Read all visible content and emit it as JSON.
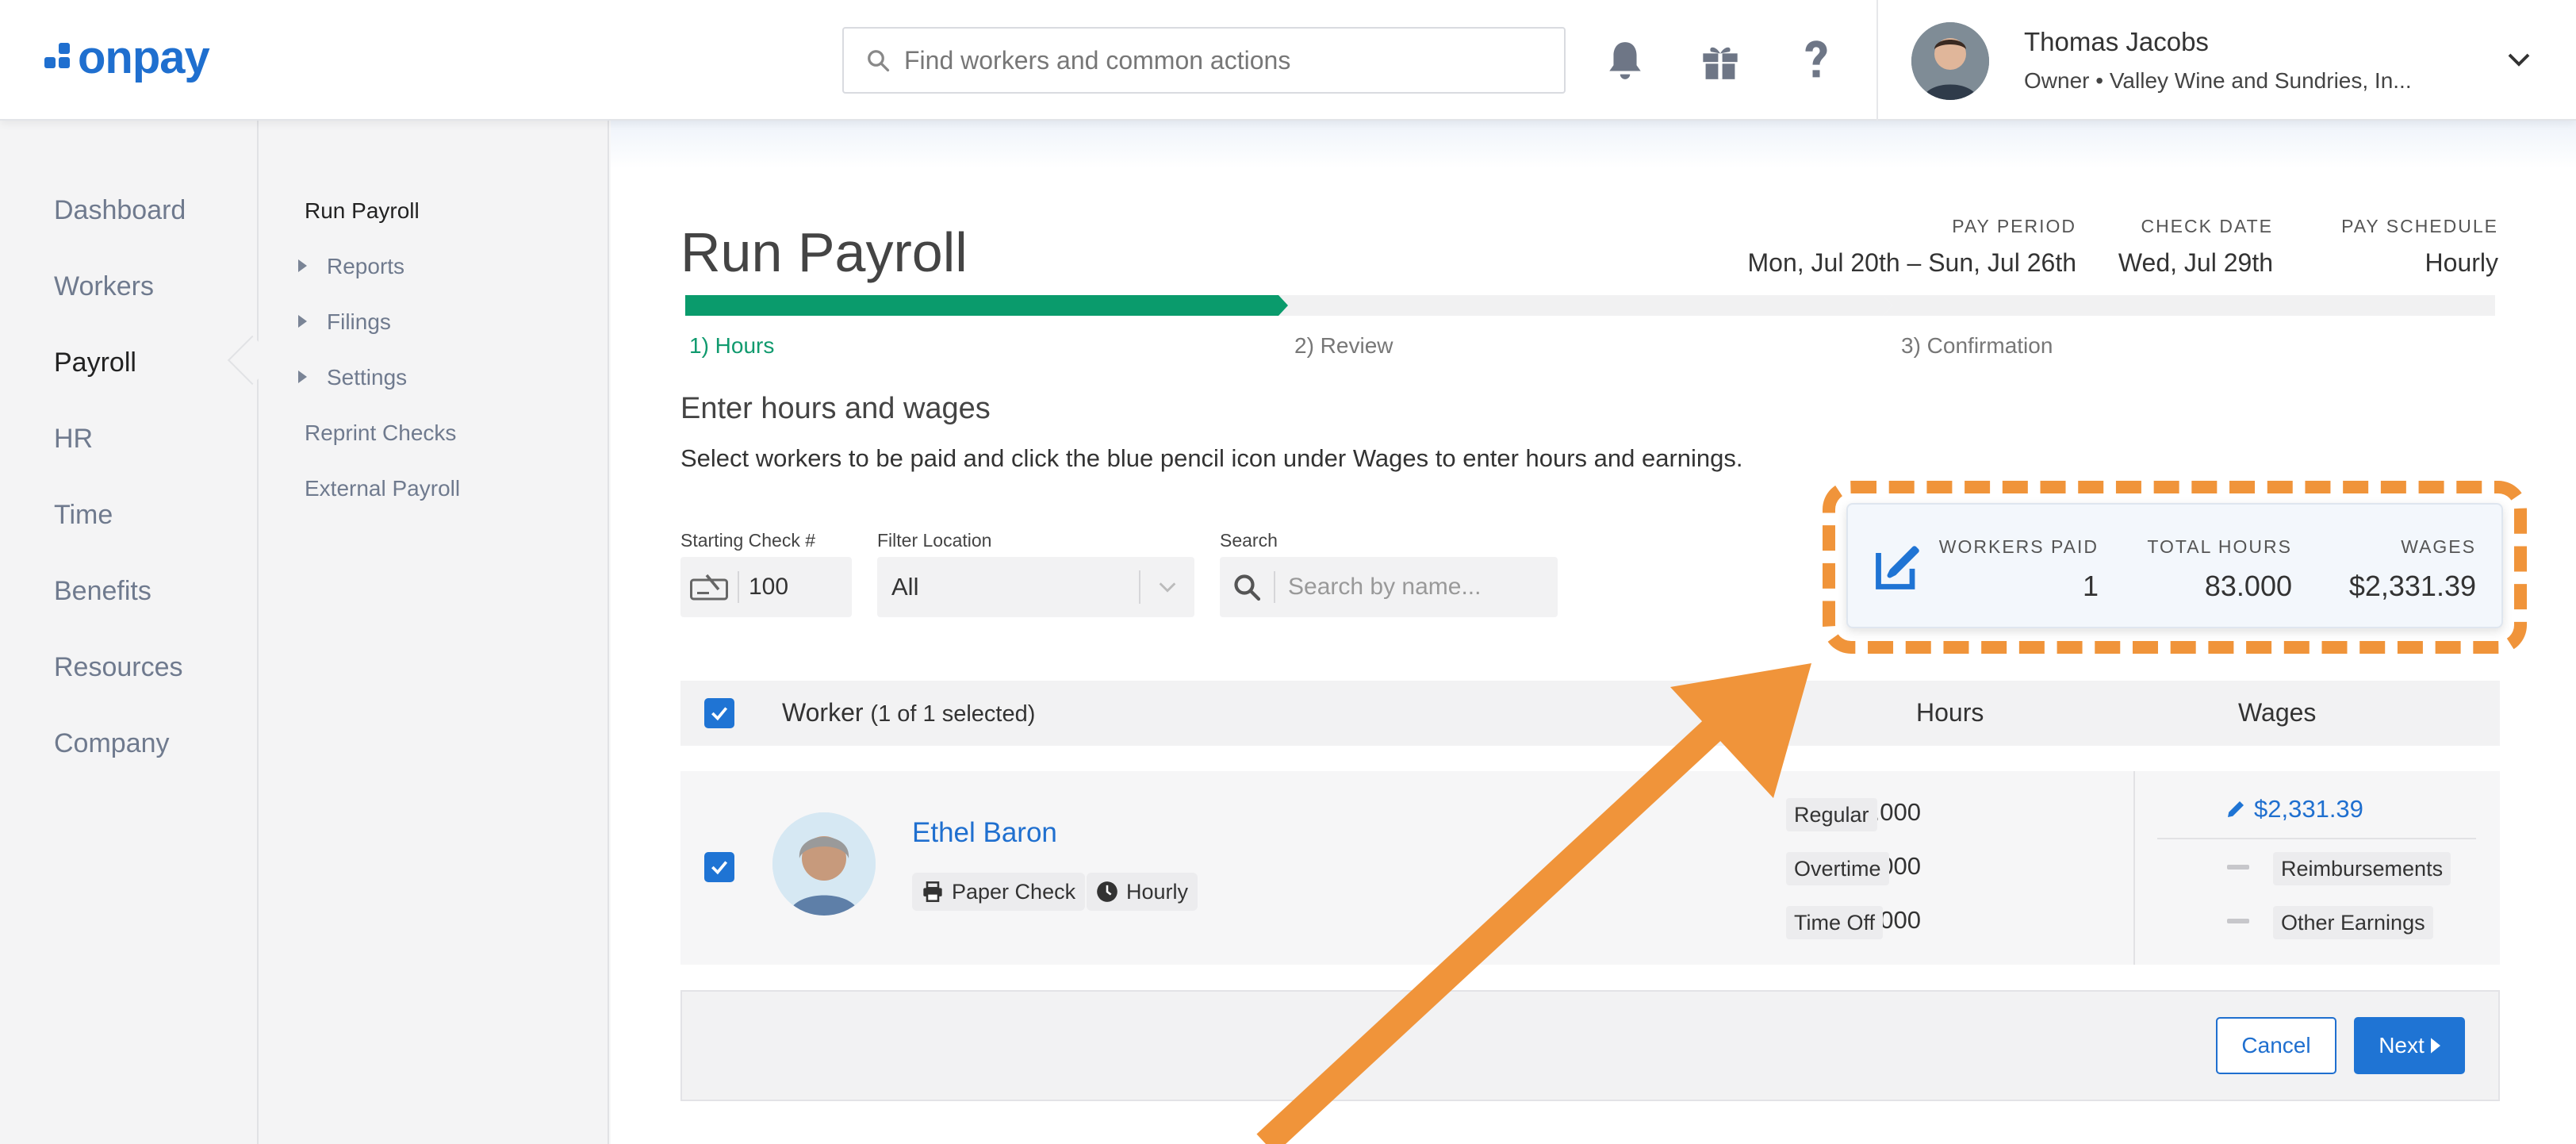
{
  "header": {
    "logo_text": "onpay",
    "search_placeholder": "Find workers and common actions",
    "user_name": "Thomas Jacobs",
    "user_role": "Owner • Valley Wine and Sundries, In..."
  },
  "nav": {
    "items": [
      "Dashboard",
      "Workers",
      "Payroll",
      "HR",
      "Time",
      "Benefits",
      "Resources",
      "Company"
    ],
    "active": "Payroll"
  },
  "subnav": {
    "items": [
      "Run Payroll",
      "Reports",
      "Filings",
      "Settings",
      "Reprint Checks",
      "External Payroll"
    ],
    "active": "Run Payroll"
  },
  "page": {
    "title": "Run Payroll",
    "pay_period_label": "PAY PERIOD",
    "pay_period_value": "Mon, Jul 20th – Sun, Jul 26th",
    "check_date_label": "CHECK DATE",
    "check_date_value": "Wed, Jul 29th",
    "pay_schedule_label": "PAY SCHEDULE",
    "pay_schedule_value": "Hourly",
    "steps": [
      "1) Hours",
      "2) Review",
      "3) Confirmation"
    ],
    "progress_fraction": 0.333,
    "section_title": "Enter hours and wages",
    "section_desc": "Select workers to be paid and click the blue pencil icon under Wages to enter hours and earnings."
  },
  "filters": {
    "starting_check_label": "Starting Check #",
    "starting_check_value": "100",
    "location_label": "Filter Location",
    "location_value": "All",
    "search_label": "Search",
    "search_placeholder": "Search by name..."
  },
  "summary": {
    "workers_paid_label": "WORKERS PAID",
    "workers_paid_value": "1",
    "total_hours_label": "TOTAL HOURS",
    "total_hours_value": "83.000",
    "wages_label": "WAGES",
    "wages_value": "$2,331.39"
  },
  "table": {
    "col_worker": "Worker",
    "col_worker_sub": "(1 of 1 selected)",
    "col_hours": "Hours",
    "col_wages": "Wages",
    "row": {
      "name": "Ethel Baron",
      "badge_payment": "Paper Check",
      "badge_type": "Hourly",
      "hours": [
        {
          "value": "40.000",
          "type": "Regular"
        },
        {
          "value": "3.000",
          "type": "Overtime"
        },
        {
          "value": "40.000",
          "type": "Time Off"
        }
      ],
      "wage_amount": "$2,331.39",
      "reimbursements": "Reimbursements",
      "other_earnings": "Other Earnings"
    }
  },
  "footer": {
    "cancel_label": "Cancel",
    "next_label": "Next"
  },
  "colors": {
    "brand_blue": "#1f74d4",
    "progress_green": "#0a9b6c",
    "highlight_orange": "#f0943a"
  }
}
